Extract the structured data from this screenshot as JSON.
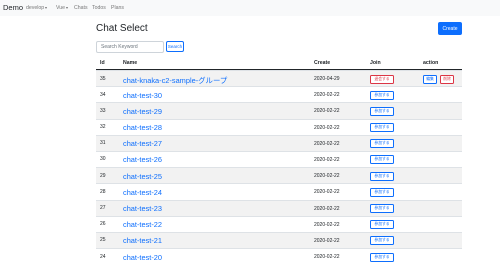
{
  "nav": {
    "brand": "Demo",
    "items": [
      {
        "label": "develop",
        "dropdown": true
      },
      {
        "label": "Vue",
        "dropdown": true
      },
      {
        "label": "Chats",
        "dropdown": false
      },
      {
        "label": "Todos",
        "dropdown": false
      },
      {
        "label": "Plans",
        "dropdown": false
      }
    ]
  },
  "page": {
    "title": "Chat Select",
    "create_label": "Create",
    "search_placeholder": "Search Keyword",
    "search_label": "Search"
  },
  "colors": {
    "primary": "#0d6efd",
    "danger": "#dc3545",
    "navbar_bg": "#f8f9fa",
    "stripe": "#f2f2f2"
  },
  "table": {
    "headers": {
      "id": "Id",
      "name": "Name",
      "create": "Create",
      "join": "Join",
      "action": "action"
    },
    "join_label": "参加する",
    "leave_label": "退会する",
    "edit_label": "編集",
    "delete_label": "削除",
    "rows": [
      {
        "id": "35",
        "name": "chat-knaka-c2-sample-グループ",
        "create": "2020-04-29",
        "joined": true
      },
      {
        "id": "34",
        "name": "chat-test-30",
        "create": "2020-02-22",
        "joined": false
      },
      {
        "id": "33",
        "name": "chat-test-29",
        "create": "2020-02-22",
        "joined": false
      },
      {
        "id": "32",
        "name": "chat-test-28",
        "create": "2020-02-22",
        "joined": false
      },
      {
        "id": "31",
        "name": "chat-test-27",
        "create": "2020-02-22",
        "joined": false
      },
      {
        "id": "30",
        "name": "chat-test-26",
        "create": "2020-02-22",
        "joined": false
      },
      {
        "id": "29",
        "name": "chat-test-25",
        "create": "2020-02-22",
        "joined": false
      },
      {
        "id": "28",
        "name": "chat-test-24",
        "create": "2020-02-22",
        "joined": false
      },
      {
        "id": "27",
        "name": "chat-test-23",
        "create": "2020-02-22",
        "joined": false
      },
      {
        "id": "26",
        "name": "chat-test-22",
        "create": "2020-02-22",
        "joined": false
      },
      {
        "id": "25",
        "name": "chat-test-21",
        "create": "2020-02-22",
        "joined": false
      },
      {
        "id": "24",
        "name": "chat-test-20",
        "create": "2020-02-22",
        "joined": false
      }
    ]
  }
}
